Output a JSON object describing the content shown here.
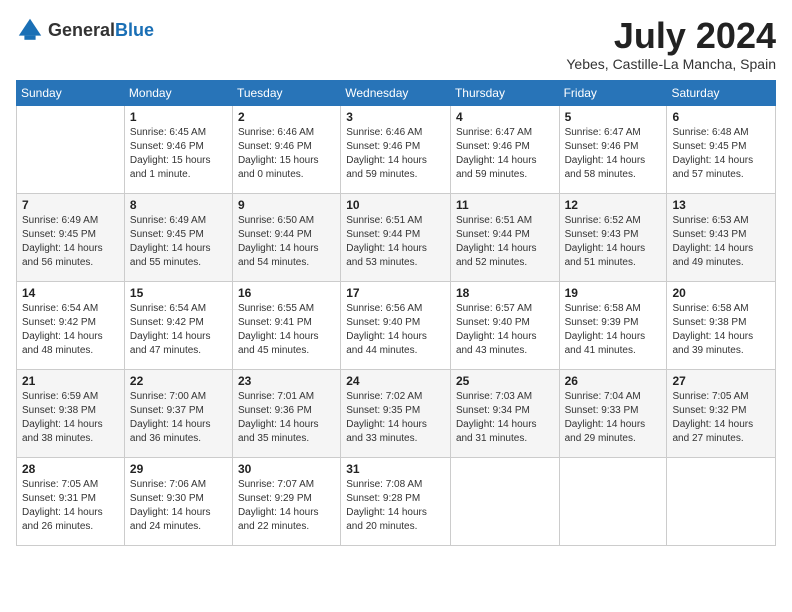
{
  "logo": {
    "text_general": "General",
    "text_blue": "Blue"
  },
  "title": {
    "month_year": "July 2024",
    "location": "Yebes, Castille-La Mancha, Spain"
  },
  "days_of_week": [
    "Sunday",
    "Monday",
    "Tuesday",
    "Wednesday",
    "Thursday",
    "Friday",
    "Saturday"
  ],
  "weeks": [
    [
      {
        "day": "",
        "info": ""
      },
      {
        "day": "1",
        "info": "Sunrise: 6:45 AM\nSunset: 9:46 PM\nDaylight: 15 hours\nand 1 minute."
      },
      {
        "day": "2",
        "info": "Sunrise: 6:46 AM\nSunset: 9:46 PM\nDaylight: 15 hours\nand 0 minutes."
      },
      {
        "day": "3",
        "info": "Sunrise: 6:46 AM\nSunset: 9:46 PM\nDaylight: 14 hours\nand 59 minutes."
      },
      {
        "day": "4",
        "info": "Sunrise: 6:47 AM\nSunset: 9:46 PM\nDaylight: 14 hours\nand 59 minutes."
      },
      {
        "day": "5",
        "info": "Sunrise: 6:47 AM\nSunset: 9:46 PM\nDaylight: 14 hours\nand 58 minutes."
      },
      {
        "day": "6",
        "info": "Sunrise: 6:48 AM\nSunset: 9:45 PM\nDaylight: 14 hours\nand 57 minutes."
      }
    ],
    [
      {
        "day": "7",
        "info": "Sunrise: 6:49 AM\nSunset: 9:45 PM\nDaylight: 14 hours\nand 56 minutes."
      },
      {
        "day": "8",
        "info": "Sunrise: 6:49 AM\nSunset: 9:45 PM\nDaylight: 14 hours\nand 55 minutes."
      },
      {
        "day": "9",
        "info": "Sunrise: 6:50 AM\nSunset: 9:44 PM\nDaylight: 14 hours\nand 54 minutes."
      },
      {
        "day": "10",
        "info": "Sunrise: 6:51 AM\nSunset: 9:44 PM\nDaylight: 14 hours\nand 53 minutes."
      },
      {
        "day": "11",
        "info": "Sunrise: 6:51 AM\nSunset: 9:44 PM\nDaylight: 14 hours\nand 52 minutes."
      },
      {
        "day": "12",
        "info": "Sunrise: 6:52 AM\nSunset: 9:43 PM\nDaylight: 14 hours\nand 51 minutes."
      },
      {
        "day": "13",
        "info": "Sunrise: 6:53 AM\nSunset: 9:43 PM\nDaylight: 14 hours\nand 49 minutes."
      }
    ],
    [
      {
        "day": "14",
        "info": "Sunrise: 6:54 AM\nSunset: 9:42 PM\nDaylight: 14 hours\nand 48 minutes."
      },
      {
        "day": "15",
        "info": "Sunrise: 6:54 AM\nSunset: 9:42 PM\nDaylight: 14 hours\nand 47 minutes."
      },
      {
        "day": "16",
        "info": "Sunrise: 6:55 AM\nSunset: 9:41 PM\nDaylight: 14 hours\nand 45 minutes."
      },
      {
        "day": "17",
        "info": "Sunrise: 6:56 AM\nSunset: 9:40 PM\nDaylight: 14 hours\nand 44 minutes."
      },
      {
        "day": "18",
        "info": "Sunrise: 6:57 AM\nSunset: 9:40 PM\nDaylight: 14 hours\nand 43 minutes."
      },
      {
        "day": "19",
        "info": "Sunrise: 6:58 AM\nSunset: 9:39 PM\nDaylight: 14 hours\nand 41 minutes."
      },
      {
        "day": "20",
        "info": "Sunrise: 6:58 AM\nSunset: 9:38 PM\nDaylight: 14 hours\nand 39 minutes."
      }
    ],
    [
      {
        "day": "21",
        "info": "Sunrise: 6:59 AM\nSunset: 9:38 PM\nDaylight: 14 hours\nand 38 minutes."
      },
      {
        "day": "22",
        "info": "Sunrise: 7:00 AM\nSunset: 9:37 PM\nDaylight: 14 hours\nand 36 minutes."
      },
      {
        "day": "23",
        "info": "Sunrise: 7:01 AM\nSunset: 9:36 PM\nDaylight: 14 hours\nand 35 minutes."
      },
      {
        "day": "24",
        "info": "Sunrise: 7:02 AM\nSunset: 9:35 PM\nDaylight: 14 hours\nand 33 minutes."
      },
      {
        "day": "25",
        "info": "Sunrise: 7:03 AM\nSunset: 9:34 PM\nDaylight: 14 hours\nand 31 minutes."
      },
      {
        "day": "26",
        "info": "Sunrise: 7:04 AM\nSunset: 9:33 PM\nDaylight: 14 hours\nand 29 minutes."
      },
      {
        "day": "27",
        "info": "Sunrise: 7:05 AM\nSunset: 9:32 PM\nDaylight: 14 hours\nand 27 minutes."
      }
    ],
    [
      {
        "day": "28",
        "info": "Sunrise: 7:05 AM\nSunset: 9:31 PM\nDaylight: 14 hours\nand 26 minutes."
      },
      {
        "day": "29",
        "info": "Sunrise: 7:06 AM\nSunset: 9:30 PM\nDaylight: 14 hours\nand 24 minutes."
      },
      {
        "day": "30",
        "info": "Sunrise: 7:07 AM\nSunset: 9:29 PM\nDaylight: 14 hours\nand 22 minutes."
      },
      {
        "day": "31",
        "info": "Sunrise: 7:08 AM\nSunset: 9:28 PM\nDaylight: 14 hours\nand 20 minutes."
      },
      {
        "day": "",
        "info": ""
      },
      {
        "day": "",
        "info": ""
      },
      {
        "day": "",
        "info": ""
      }
    ]
  ]
}
